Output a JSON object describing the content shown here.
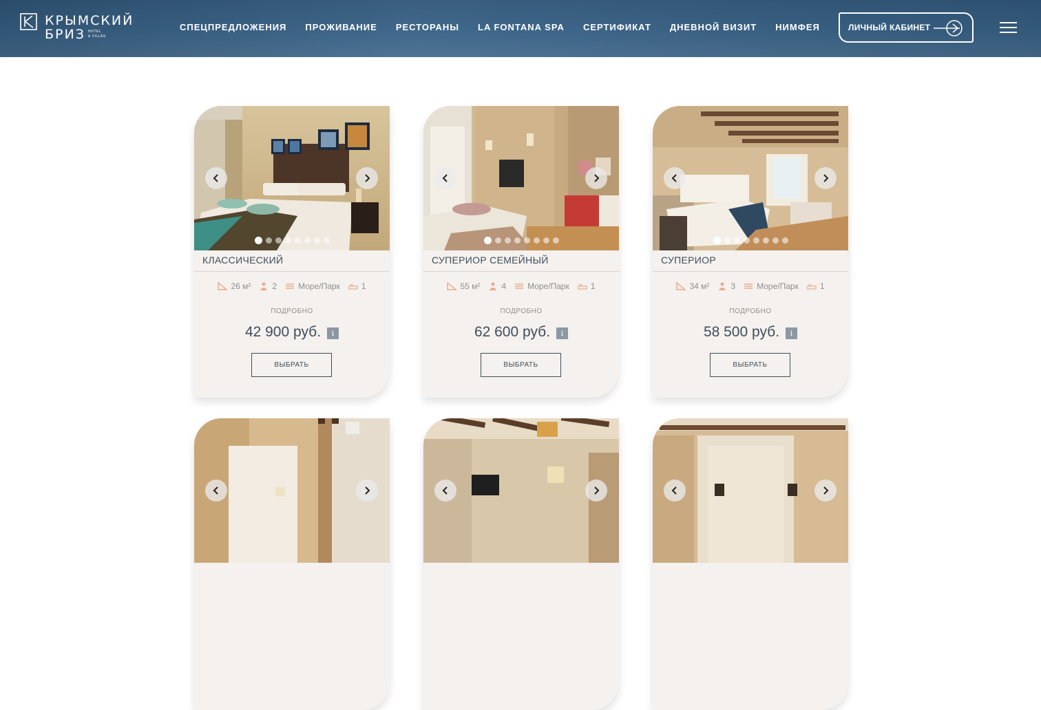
{
  "header": {
    "logo": {
      "line1": "КРЫМСКИЙ",
      "line2": "БРИЗ",
      "sub1": "HOTEL",
      "sub2": "& VILLAS"
    },
    "nav": [
      "СПЕЦПРЕДЛОЖЕНИЯ",
      "ПРОЖИВАНИЕ",
      "РЕСТОРАНЫ",
      "LA FONTANA SPA",
      "СЕРТИФИКАТ",
      "ДНЕВНОЙ ВИЗИТ",
      "НИМФЕЯ"
    ],
    "cabinet_label": "ЛИЧНЫЙ КАБИНЕТ",
    "colors": {
      "header_bg": "#3a6488",
      "text": "#ffffff"
    }
  },
  "rooms": [
    {
      "title": "КЛАССИЧЕСКИЙ",
      "area": "26 м²",
      "guests": "2",
      "view": "Море/Парк",
      "beds": "1",
      "more": "ПОДРОБНО",
      "price": "42 900 руб.",
      "choose": "ВЫБРАТЬ",
      "info": "i"
    },
    {
      "title": "СУПЕРИОР СЕМЕЙНЫЙ",
      "area": "55 м²",
      "guests": "4",
      "view": "Море/Парк",
      "beds": "1",
      "more": "ПОДРОБНО",
      "price": "62 600 руб.",
      "choose": "ВЫБРАТЬ",
      "info": "i"
    },
    {
      "title": "СУПЕРИОР",
      "area": "34 м²",
      "guests": "3",
      "view": "Море/Парк",
      "beds": "1",
      "more": "ПОДРОБНО",
      "price": "58 500 руб.",
      "choose": "ВЫБРАТЬ",
      "info": "i"
    },
    {
      "title": "",
      "area": "",
      "guests": "",
      "view": "",
      "beds": "",
      "more": "",
      "price": "",
      "choose": "",
      "info": ""
    },
    {
      "title": "",
      "area": "",
      "guests": "",
      "view": "",
      "beds": "",
      "more": "",
      "price": "",
      "choose": "",
      "info": ""
    },
    {
      "title": "",
      "area": "",
      "guests": "",
      "view": "",
      "beds": "",
      "more": "",
      "price": "",
      "choose": "",
      "info": ""
    }
  ],
  "slider": {
    "dots_count": 8,
    "active_index": 0
  },
  "colors": {
    "card_bg": "#f4f1ee",
    "text": "#3f4d5a",
    "muted": "#8f8f8f",
    "feature_icon": "#e9a98a",
    "info_bg": "#8c98a3"
  }
}
